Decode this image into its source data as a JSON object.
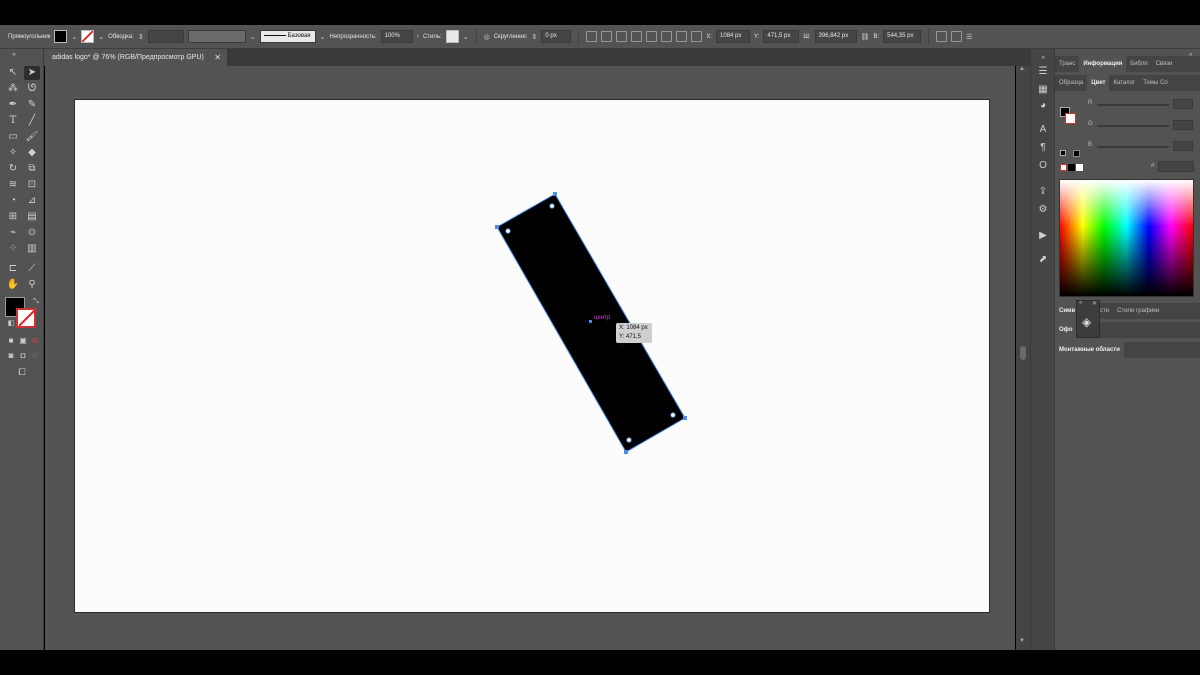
{
  "control_bar": {
    "tool_name": "Прямоугольник",
    "stroke_label": "Обводка:",
    "stroke_profile": "Базовая",
    "opacity_label": "Непрозрачность:",
    "opacity_value": "100%",
    "style_label": "Стиль:",
    "corner_label": "Скругление:",
    "corner_value": "0 px",
    "x_label": "X:",
    "x_value": "1084 px",
    "y_label": "Y:",
    "y_value": "471,5 px",
    "w_label": "Ш:",
    "w_value": "396,842 px",
    "h_label": "В:",
    "h_value": "544,35 px",
    "fill_color": "#000000"
  },
  "document": {
    "tab_title": "adidas logo* @ 76% (RGB/Предпросмотр GPU)",
    "close_glyph": "✕"
  },
  "canvas": {
    "center_label": "центр",
    "tooltip_x": "X: 1084 px",
    "tooltip_y": "Y: 471,5 px",
    "shape_fill": "#000000",
    "selection_color": "#4a8fe6"
  },
  "right_panel": {
    "tabs_row1": [
      "Транс",
      "Информация",
      "Библи",
      "Связи"
    ],
    "tabs_row2": [
      "Образца",
      "Цвет",
      "Каталог",
      "Темы Co"
    ],
    "sliders": [
      {
        "label": "R"
      },
      {
        "label": "G"
      },
      {
        "label": "B"
      }
    ],
    "hash_label": "#",
    "tabs_row3": [
      "Симв",
      "Кисти",
      "Стили графики"
    ],
    "tabs_row4": [
      "Офо"
    ],
    "tabs_row5": [
      "Монтажные области"
    ]
  },
  "icons": {
    "selection": "selection-arrow-icon",
    "direct_selection": "direct-selection-icon",
    "layers": "layers-icon"
  }
}
